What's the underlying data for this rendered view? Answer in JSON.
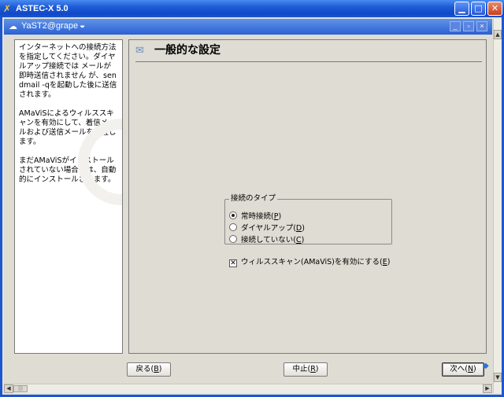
{
  "outer_window": {
    "title": "ASTEC-X 5.0",
    "min_glyph": "▁",
    "max_glyph": "□",
    "close_glyph": "✕"
  },
  "inner_window": {
    "title": "YaST2@grape",
    "min_glyph": "_",
    "restore_glyph": "▫",
    "close_glyph": "×"
  },
  "help": {
    "p1": "インターネットへの接続方法を指定してください。ダイヤルアップ接続では メールが即時送信されません が、sendmail -qを起動した後に送信されます。",
    "p2": "AMaViSによるウィルススキャンを有効にして、着信メールおよび送信メールを検査します。",
    "p3": "まだAMaViSがインストールされていない場合には、自動的にインストールされます。"
  },
  "main": {
    "heading": "一般的な設定",
    "connection_group": {
      "legend": "接続のタイプ",
      "options": [
        {
          "label": "常時接続(",
          "mnemonic": "P",
          "tail": ")",
          "selected": true
        },
        {
          "label": "ダイヤルアップ(",
          "mnemonic": "D",
          "tail": ")",
          "selected": false
        },
        {
          "label": "接続していない(",
          "mnemonic": "C",
          "tail": ")",
          "selected": false
        }
      ]
    },
    "virus_scan": {
      "label": "ウィルススキャン(AMaViS)を有効にする(",
      "mnemonic": "E",
      "tail": ")",
      "checked": true,
      "check_glyph": "✕"
    }
  },
  "buttons": {
    "back": {
      "label": "戻る(",
      "mnemonic": "B",
      "tail": ")"
    },
    "abort": {
      "label": "中止(",
      "mnemonic": "R",
      "tail": ")"
    },
    "next": {
      "label": "次へ(",
      "mnemonic": "N",
      "tail": ")"
    }
  },
  "scrollbar": {
    "up": "▲",
    "down": "▼",
    "left": "◀",
    "right": "▶",
    "grip": "|||"
  },
  "colors": {
    "xp_title_blue": "#1E5BD6",
    "close_red": "#C6401E",
    "panel_bg": "#DEDCD3"
  }
}
